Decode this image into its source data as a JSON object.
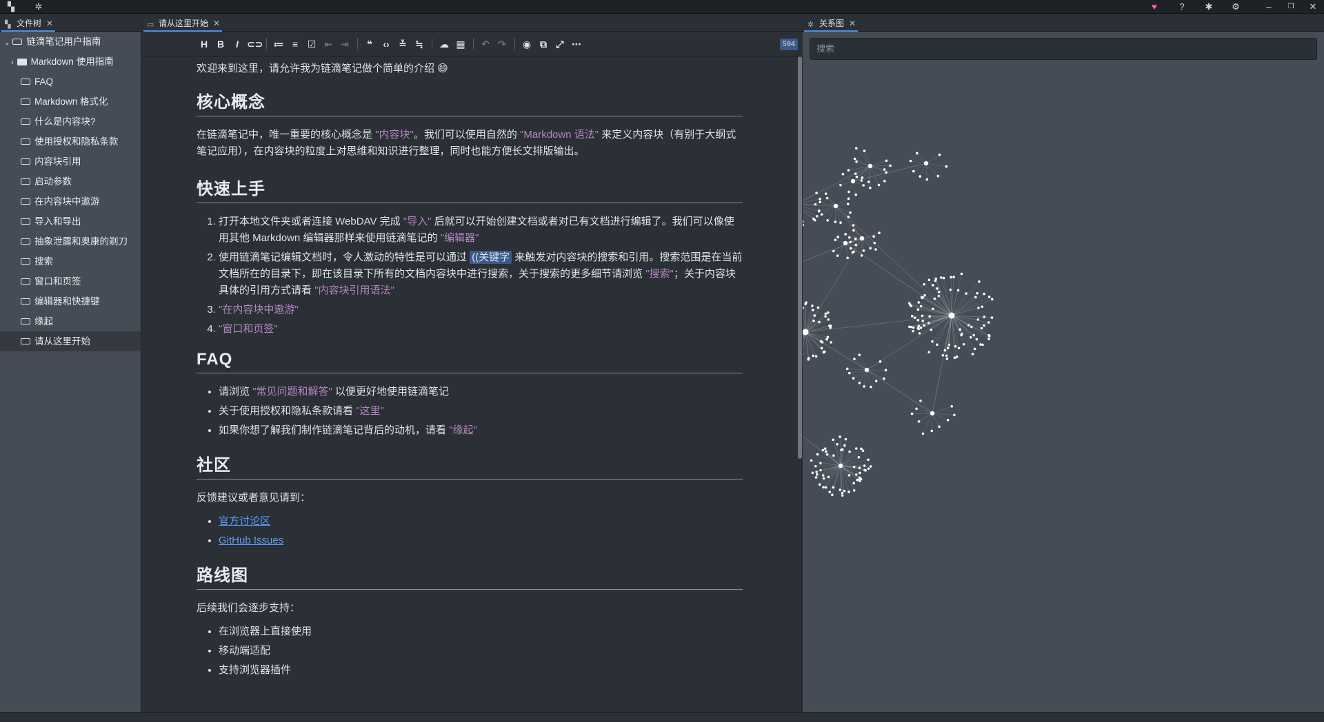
{
  "tabs": {
    "files": "文件树",
    "doc": "请从这里开始",
    "graph": "关系图"
  },
  "sidebar": {
    "root": "链滴笔记用户指南",
    "items": [
      {
        "label": "Markdown 使用指南",
        "type": "folder"
      },
      {
        "label": "FAQ"
      },
      {
        "label": "Markdown 格式化"
      },
      {
        "label": "什么是内容块?"
      },
      {
        "label": "使用授权和隐私条款"
      },
      {
        "label": "内容块引用"
      },
      {
        "label": "启动参数"
      },
      {
        "label": "在内容块中遨游"
      },
      {
        "label": "导入和导出"
      },
      {
        "label": "抽象泄露和奥康的剃刀"
      },
      {
        "label": "搜索"
      },
      {
        "label": "窗口和页签"
      },
      {
        "label": "编辑器和快捷键"
      },
      {
        "label": "缘起"
      },
      {
        "label": "请从这里开始",
        "active": true
      }
    ]
  },
  "toolbar": {
    "wordcount": "594",
    "icons": [
      "heading-icon",
      "bold-icon",
      "italic-icon",
      "link-icon",
      "bullet-list-icon",
      "ordered-list-icon",
      "checklist-icon",
      "outdent-icon",
      "indent-icon",
      "quote-icon",
      "code-icon",
      "inline-code-icon",
      "clear-format-icon",
      "upload-icon",
      "table-icon",
      "undo-icon",
      "redo-icon",
      "preview-icon",
      "export-icon",
      "fullscreen-icon",
      "more-icon"
    ]
  },
  "doc": {
    "intro": "欢迎来到这里，请允许我为链滴笔记做个简单的介绍 😄",
    "h_core": "核心概念",
    "core_p1": "在链滴笔记中，唯一重要的核心概念是",
    "core_ref1": "\"内容块\"",
    "core_p2": "。我们可以使用自然的",
    "core_ref2": "\"Markdown 语法\"",
    "core_p3": "来定义内容块（有别于大纲式笔记应用），在内容块的粒度上对思维和知识进行整理，同时也能方便长文排版输出。",
    "h_quick": "快速上手",
    "q1a": "打开本地文件夹或者连接 WebDAV 完成",
    "q1ref": "\"导入\"",
    "q1b": "后就可以开始创建文档或者对已有文档进行编辑了。我们可以像使用其他 Markdown 编辑器那样来使用链滴笔记的",
    "q1ref2": "\"编辑器\"",
    "q2a": "使用链滴笔记编辑文档时，令人激动的特性是可以通过",
    "q2kw": "((关键字",
    "q2b": "来触发对内容块的搜索和引用。搜索范围是在当前文档所在的目录下，即在该目录下所有的文档内容块中进行搜索，关于搜索的更多细节请浏览",
    "q2ref": "\"搜索\"",
    "q2c": "；关于内容块具体的引用方式请看",
    "q2ref2": "\"内容块引用语法\"",
    "q3": "\"在内容块中遨游\"",
    "q4": "\"窗口和页签\"",
    "h_faq": "FAQ",
    "f1a": "请浏览",
    "f1ref": "\"常见问题和解答\"",
    "f1b": "以便更好地使用链滴笔记",
    "f2a": "关于使用授权和隐私条款请看",
    "f2ref": "\"这里\"",
    "f3a": "如果你想了解我们制作链滴笔记背后的动机，请看",
    "f3ref": "\"缘起\"",
    "h_comm": "社区",
    "comm_p": "反馈建议或者意见请到：",
    "comm_l1": "官方讨论区",
    "comm_l2": "GitHub Issues",
    "h_road": "路线图",
    "road_p": "后续我们会逐步支持：",
    "r1": "在浏览器上直接使用",
    "r2": "移动端适配",
    "r3": "支持浏览器插件"
  },
  "graph": {
    "search_placeholder": "搜索",
    "node_color": "#ffffff",
    "edge_color": "#8a7070"
  }
}
